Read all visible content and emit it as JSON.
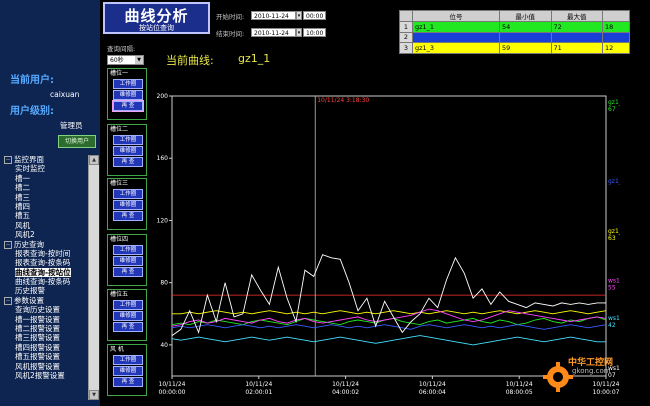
{
  "header": {
    "title": "曲线分析",
    "subtitle": "按站位查询",
    "start_label": "开始时间:",
    "start_date": "2010-11-24",
    "start_time": "00:00",
    "end_label": "结束时间:",
    "end_date": "2010-11-24",
    "end_time": "10:00"
  },
  "user": {
    "label": "当前用户:",
    "name": "caixuan",
    "level_label": "用户级别:",
    "level": "管理员",
    "switch_button": "切换用户"
  },
  "interval": {
    "label": "查询间隔:",
    "value": "60秒"
  },
  "current_curve": {
    "label": "当前曲线:",
    "value": "gz1_1"
  },
  "tree": [
    {
      "label": "监控界面",
      "group": true
    },
    {
      "label": "实时监控"
    },
    {
      "label": "槽一"
    },
    {
      "label": "槽二"
    },
    {
      "label": "槽三"
    },
    {
      "label": "槽四"
    },
    {
      "label": "槽五"
    },
    {
      "label": "风机"
    },
    {
      "label": "风机2"
    },
    {
      "label": "历史查询",
      "group": true
    },
    {
      "label": "报表查询-按时间"
    },
    {
      "label": "报表查询-按条码"
    },
    {
      "label": "曲线查询-按站位",
      "selected": true
    },
    {
      "label": "曲线查询-按条码"
    },
    {
      "label": "历史报警"
    },
    {
      "label": "参数设置",
      "group": true
    },
    {
      "label": "查询历史设置"
    },
    {
      "label": "槽一报警设置"
    },
    {
      "label": "槽二报警设置"
    },
    {
      "label": "槽三报警设置"
    },
    {
      "label": "槽四报警设置"
    },
    {
      "label": "槽五报警设置"
    },
    {
      "label": "风机报警设置"
    },
    {
      "label": "风机2报警设置"
    }
  ],
  "groups": [
    {
      "title": "槽位一",
      "buttons": [
        "工作圈",
        "维修圈",
        "再 查"
      ]
    },
    {
      "title": "槽位二",
      "buttons": [
        "工作圈",
        "维修圈",
        "再 查"
      ]
    },
    {
      "title": "槽位三",
      "buttons": [
        "工作圈",
        "维修圈",
        "再 查"
      ]
    },
    {
      "title": "槽位四",
      "buttons": [
        "工作圈",
        "维修圈",
        "再 查"
      ]
    },
    {
      "title": "槽位五",
      "buttons": [
        "工作圈",
        "维修圈",
        "再 查"
      ]
    },
    {
      "title": "风 机",
      "buttons": [
        "工作圈",
        "维修圈",
        "再 查"
      ]
    }
  ],
  "legend": {
    "headers": [
      "位号",
      "最小值",
      "最大值"
    ],
    "rows": [
      {
        "index": "1",
        "tag": "gz1_1",
        "min": "54",
        "max": "72",
        "value": "18",
        "color": "#22e822"
      },
      {
        "index": "2",
        "tag": "",
        "min": "",
        "max": "",
        "value": "",
        "color": "#1a3fd6"
      },
      {
        "index": "3",
        "tag": "gz1_3",
        "min": "59",
        "max": "71",
        "value": "12",
        "color": "#ffff00"
      }
    ]
  },
  "logo": {
    "text": "中华工控网",
    "url": "gkong.com"
  },
  "chart_data": {
    "type": "line",
    "ylim": [
      20,
      200
    ],
    "y_ticks": [
      "200",
      "160",
      "120",
      "80",
      "40"
    ],
    "x_ticks": [
      [
        "10/11/24",
        "00:00:00"
      ],
      [
        "10/11/24",
        "02:00:01"
      ],
      [
        "10/11/24",
        "04:00:02"
      ],
      [
        "10/11/24",
        "06:00:04"
      ],
      [
        "10/11/24",
        "08:00:05"
      ],
      [
        "10/11/24",
        "10:00:07"
      ]
    ],
    "cursor_label": "10/11/24 3:18:30",
    "cursor_time_hours": 3.3,
    "threshold": 72,
    "right_labels": [
      {
        "text": "gz1_1",
        "value": "67",
        "color": "#22e822",
        "y": 195
      },
      {
        "text": "gz1_2",
        "value": "",
        "color": "#3a5bff",
        "y": 144
      },
      {
        "text": "gz1_3",
        "value": "63",
        "color": "#ffff00",
        "y": 112
      },
      {
        "text": "ws1_1",
        "value": "55",
        "color": "#ff44ff",
        "y": 80
      },
      {
        "text": "ws1_2",
        "value": "42",
        "color": "#44e0ff",
        "y": 56
      },
      {
        "text": "ws1_3",
        "value": "07",
        "color": "#ffffff",
        "y": 24
      }
    ],
    "series": [
      {
        "name": "gz1_1",
        "color": "#22e822",
        "values": [
          53,
          54,
          53,
          55,
          54,
          56,
          55,
          54,
          53,
          55,
          56,
          55,
          54,
          53,
          55,
          57,
          56,
          55,
          54,
          53,
          55,
          56,
          55,
          54,
          56,
          57,
          55,
          54,
          53,
          55,
          56,
          54,
          55,
          56,
          57,
          55,
          54,
          56,
          55,
          53,
          54,
          56,
          57,
          55,
          54,
          56,
          55,
          57,
          58,
          56
        ]
      },
      {
        "name": "gz1_2",
        "color": "#3a5bff",
        "values": [
          51,
          52,
          51,
          52,
          53,
          52,
          51,
          52,
          53,
          52,
          51,
          52,
          51,
          52,
          53,
          52,
          51,
          52,
          53,
          52,
          51,
          52,
          51,
          52,
          53,
          52,
          51,
          50,
          52,
          53,
          52,
          51,
          52,
          53,
          52,
          51,
          52,
          51,
          52,
          53,
          52,
          51,
          50,
          51,
          52,
          53,
          52,
          51,
          52,
          53
        ]
      },
      {
        "name": "gz1_3",
        "color": "#ffff00",
        "values": [
          60,
          60,
          61,
          60,
          61,
          62,
          61,
          60,
          61,
          60,
          61,
          62,
          61,
          60,
          61,
          60,
          61,
          60,
          61,
          62,
          61,
          60,
          61,
          60,
          61,
          62,
          61,
          60,
          61,
          60,
          61,
          62,
          61,
          60,
          61,
          60,
          61,
          62,
          61,
          60,
          61,
          62,
          61,
          60,
          61,
          62,
          61,
          60,
          61,
          62
        ]
      },
      {
        "name": "ws1_1",
        "color": "#ff44ff",
        "values": [
          52,
          53,
          55,
          56,
          54,
          55,
          57,
          56,
          55,
          54,
          56,
          57,
          55,
          54,
          56,
          57,
          55,
          54,
          55,
          56,
          57,
          58,
          56,
          55,
          56,
          57,
          58,
          59,
          61,
          63,
          62,
          60,
          58,
          56,
          55,
          56,
          58,
          60,
          62,
          61,
          60,
          59,
          58,
          57,
          56,
          55,
          56,
          57,
          58,
          57
        ]
      },
      {
        "name": "ws1_2",
        "color": "#44e0ff",
        "values": [
          44,
          43,
          44,
          45,
          44,
          43,
          42,
          43,
          44,
          45,
          44,
          43,
          44,
          45,
          44,
          43,
          42,
          43,
          44,
          45,
          44,
          43,
          42,
          41,
          42,
          43,
          44,
          45,
          46,
          45,
          44,
          43,
          42,
          41,
          40,
          41,
          42,
          43,
          44,
          45,
          44,
          43,
          42,
          43,
          44,
          45,
          44,
          43,
          42,
          42
        ]
      },
      {
        "name": "ws1_3",
        "color": "#ffffff",
        "values": [
          46,
          50,
          62,
          48,
          72,
          55,
          80,
          58,
          60,
          85,
          75,
          66,
          90,
          70,
          55,
          88,
          84,
          98,
          96,
          95,
          80,
          62,
          70,
          52,
          68,
          58,
          48,
          55,
          60,
          70,
          64,
          82,
          96,
          86,
          70,
          76,
          66,
          74,
          68,
          66,
          64,
          67,
          66,
          65,
          67,
          66,
          67,
          66,
          67,
          67
        ]
      }
    ]
  }
}
